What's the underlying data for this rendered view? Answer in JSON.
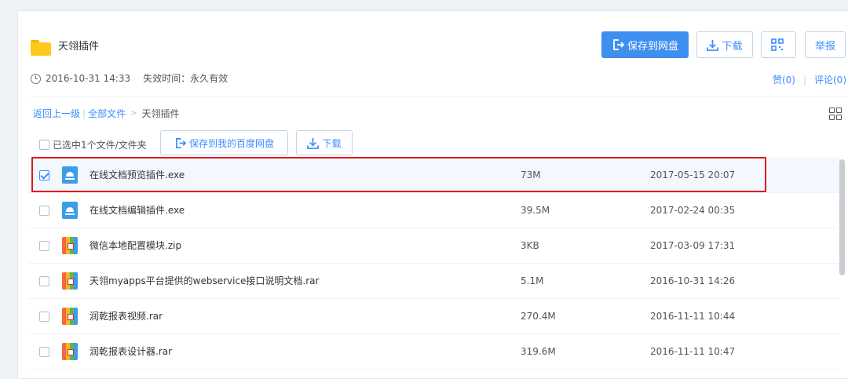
{
  "share": {
    "title": "天翎插件",
    "date": "2016-10-31 14:33",
    "expire": "失效时间：永久有效"
  },
  "header_buttons": {
    "save": "保存到网盘",
    "download": "下载",
    "report": "举报"
  },
  "links": {
    "like": "赞(0)",
    "comment": "评论(0)"
  },
  "breadcrumb": {
    "back": "返回上一级",
    "all": "全部文件",
    "current": "天翎插件"
  },
  "toolbar": {
    "selected": "已选中1个文件/文件夹",
    "save": "保存到我的百度网盘",
    "download": "下载"
  },
  "colors": {
    "accent": "#3f8ff0",
    "highlight": "#e0191d"
  },
  "files": [
    {
      "name": "在线文档预览插件.exe",
      "size": "73M",
      "date": "2017-05-15 20:07",
      "icon": "exe-icon",
      "selected": true
    },
    {
      "name": "在线文档编辑插件.exe",
      "size": "39.5M",
      "date": "2017-02-24 00:35",
      "icon": "exe-icon",
      "selected": false
    },
    {
      "name": "微信本地配置模块.zip",
      "size": "3KB",
      "date": "2017-03-09 17:31",
      "icon": "archive-icon",
      "selected": false
    },
    {
      "name": "天翎myapps平台提供的webservice接口说明文档.rar",
      "size": "5.1M",
      "date": "2016-10-31 14:26",
      "icon": "archive-icon",
      "selected": false
    },
    {
      "name": "润乾报表视频.rar",
      "size": "270.4M",
      "date": "2016-11-11 10:44",
      "icon": "archive-icon",
      "selected": false
    },
    {
      "name": "润乾报表设计器.rar",
      "size": "319.6M",
      "date": "2016-11-11 10:47",
      "icon": "archive-icon",
      "selected": false
    }
  ]
}
